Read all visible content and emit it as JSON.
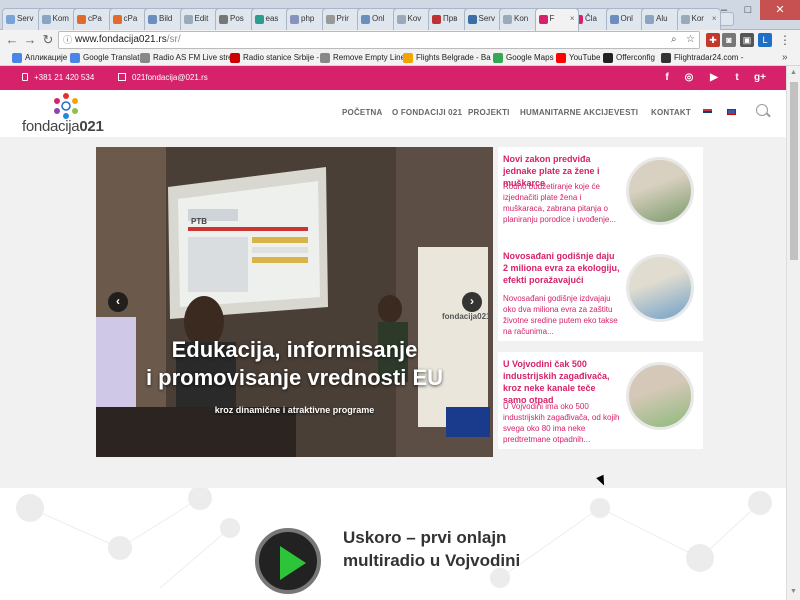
{
  "browser": {
    "tabs": [
      {
        "label": "Serv"
      },
      {
        "label": "Kom"
      },
      {
        "label": "cPa"
      },
      {
        "label": "cPa"
      },
      {
        "label": "Bild"
      },
      {
        "label": "Edit"
      },
      {
        "label": "Pos"
      },
      {
        "label": "eas"
      },
      {
        "label": "php"
      },
      {
        "label": "Prir"
      },
      {
        "label": "Onl"
      },
      {
        "label": "Kov"
      },
      {
        "label": "Прв"
      },
      {
        "label": "Serv"
      },
      {
        "label": "Kon"
      },
      {
        "label": "F"
      },
      {
        "label": "Čla"
      },
      {
        "label": "Onl"
      },
      {
        "label": "Alu"
      },
      {
        "label": "Kor"
      }
    ],
    "url_host": "www.fondacija021.rs",
    "url_path": "/sr/",
    "bookmarks": [
      {
        "label": "Апликације",
        "color": "#4a86e8"
      },
      {
        "label": "Google Translate",
        "color": "#4a86e8"
      },
      {
        "label": "Radio AS FM Live stre",
        "color": "#888888"
      },
      {
        "label": "Radio stanice Srbije -",
        "color": "#cc0000"
      },
      {
        "label": "Remove Empty Lines",
        "color": "#888888"
      },
      {
        "label": "Flights Belgrade - Ba",
        "color": "#f4a300"
      },
      {
        "label": "Google Maps",
        "color": "#34a853"
      },
      {
        "label": "YouTube",
        "color": "#ff0000"
      },
      {
        "label": "Offerconfig",
        "color": "#222222"
      },
      {
        "label": "Flightradar24.com -",
        "color": "#333333"
      }
    ],
    "overflow": "»"
  },
  "site": {
    "accent": "#d6226b",
    "phone": "+381 21 420 534",
    "email": "021fondacija@021.rs",
    "social": [
      "f",
      "◎",
      "▶",
      "t",
      "g+"
    ],
    "logo": {
      "word": "fondacija",
      "num": "021"
    },
    "nav": [
      "POČETNA",
      "O FONDACIJI 021",
      "PROJEKTI",
      "HUMANITARNE AKCIJE",
      "VESTI",
      "KONTAKT"
    ],
    "slide": {
      "title_line1": "Edukacija, informisanje",
      "title_line2": "i promovisanje vrednosti EU",
      "subtitle": "kroz dinamične i atraktivne programe",
      "screen_text": "PTB",
      "banner_text": "fondacija021"
    },
    "news": [
      {
        "title": "Novi zakon predviđa jednake plate za žene i muškarce",
        "text": "Rodno budžetiranje koje će izjednačiti plate žena i muškaraca, zabrana pitanja o planiranju porodice i uvođenje..."
      },
      {
        "title": "Novosađani godišnje daju 2 miliona evra za ekologiju, efekti poražavajući",
        "text": "Novosađani godišnje izdvajaju oko dva miliona evra za zaštitu životne sredine putem eko takse na računima..."
      },
      {
        "title": "U Vojvodini čak 500 industrijskih zagađivača, kroz neke kanale teče samo otpad",
        "text": "U Vojvodini ima oko 500 industrijskih zagađivača, od kojih svega oko 80 ima neke predtretmane otpadnih..."
      }
    ],
    "radio": {
      "line1": "Uskoro – prvi onlajn",
      "line2": "multiradio u Vojvodini"
    }
  }
}
